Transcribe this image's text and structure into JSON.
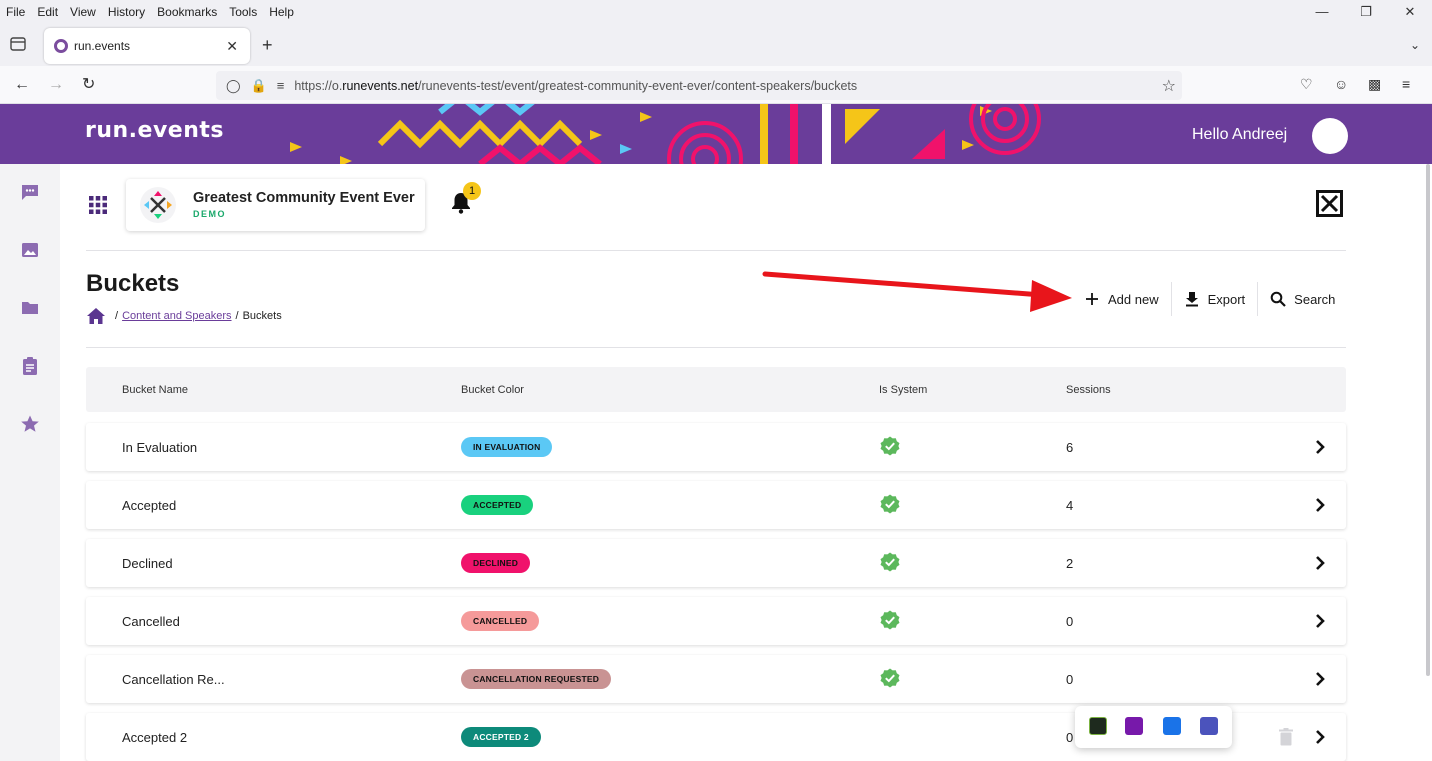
{
  "browser": {
    "menu": [
      "File",
      "Edit",
      "View",
      "History",
      "Bookmarks",
      "Tools",
      "Help"
    ],
    "window_controls": [
      "—",
      "❐",
      "✕"
    ],
    "tab": {
      "title": "run.events",
      "close": "✕"
    },
    "new_tab": "+",
    "url": {
      "prefix": "https://o.",
      "domain": "runevents.net",
      "path": "/runevents-test/event/greatest-community-event-ever/content-speakers/buckets"
    }
  },
  "banner": {
    "logo": "run.events",
    "greeting": "Hello Andreej"
  },
  "event": {
    "name": "Greatest Community Event Ever",
    "tag": "DEMO",
    "notification_count": "1"
  },
  "page": {
    "title": "Buckets",
    "breadcrumb": {
      "separator": "/",
      "parent": "Content and Speakers",
      "current": "Buckets"
    }
  },
  "actions": {
    "add_new": "Add new",
    "export": "Export",
    "search": "Search"
  },
  "table": {
    "headers": {
      "name": "Bucket Name",
      "color": "Bucket Color",
      "system": "Is System",
      "sessions": "Sessions"
    },
    "rows": [
      {
        "name": "In Evaluation",
        "pill": "IN EVALUATION",
        "color": "#5bc8f5",
        "system": true,
        "sessions": "6"
      },
      {
        "name": "Accepted",
        "pill": "ACCEPTED",
        "color": "#19d17e",
        "system": true,
        "sessions": "4"
      },
      {
        "name": "Declined",
        "pill": "DECLINED",
        "color": "#f0126b",
        "system": true,
        "sessions": "2"
      },
      {
        "name": "Cancelled",
        "pill": "CANCELLED",
        "color": "#f59a9a",
        "system": true,
        "sessions": "0"
      },
      {
        "name": "Cancellation Re...",
        "pill": "CANCELLATION REQUESTED",
        "color": "#c99393",
        "system": true,
        "sessions": "0"
      },
      {
        "name": "Accepted 2",
        "pill": "ACCEPTED 2",
        "color": "#0d8a7a",
        "system": false,
        "sessions": "0"
      }
    ]
  },
  "colors": {
    "brand": "#6a3d9a",
    "check": "#5cb85c",
    "arrow": "#e8151b"
  }
}
